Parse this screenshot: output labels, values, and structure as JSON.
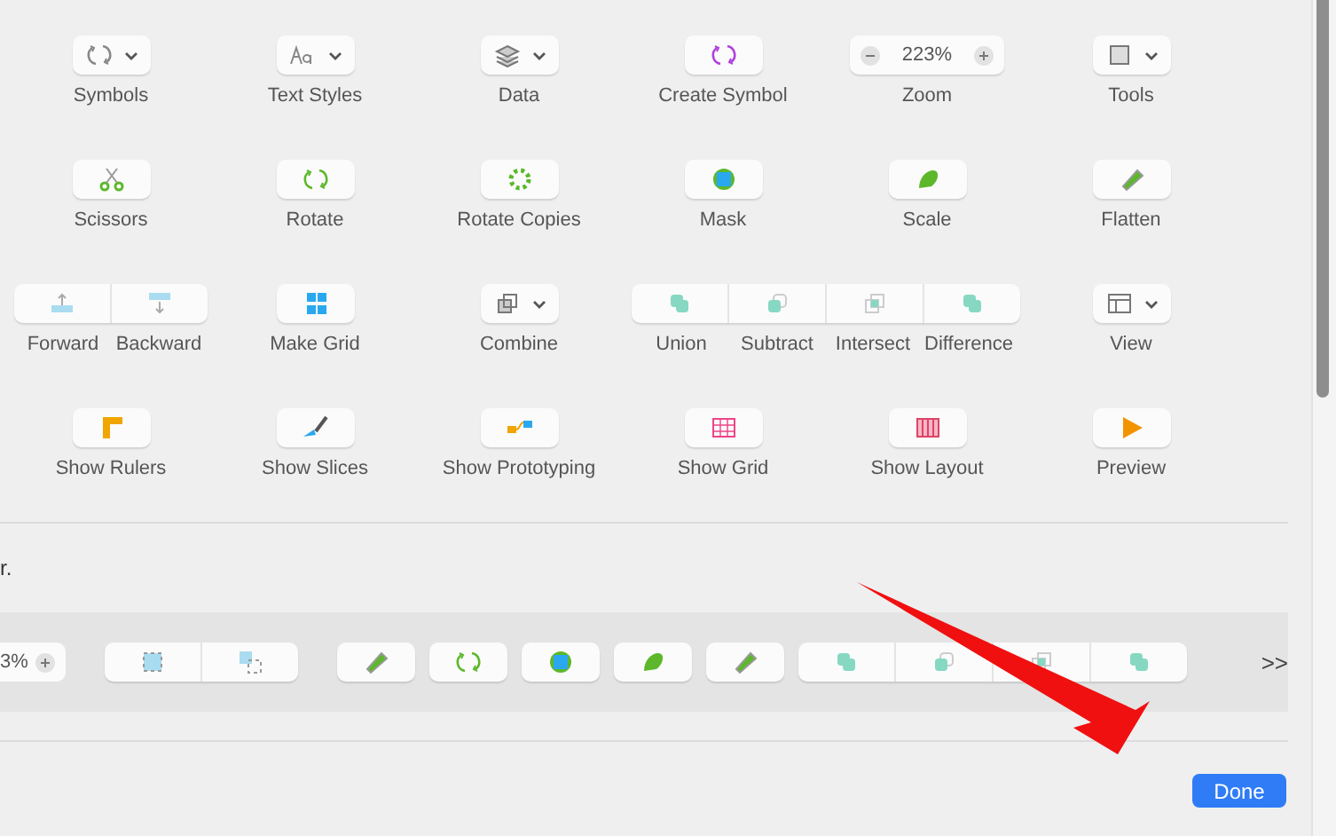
{
  "toolbar_items": [
    {
      "items": [
        {
          "kind": "dropdown",
          "label": "Symbols"
        },
        {
          "kind": "dropdown",
          "label": "Text Styles"
        },
        {
          "kind": "dropdown",
          "label": "Data"
        },
        {
          "kind": "button",
          "label": "Create Symbol"
        },
        {
          "kind": "zoom",
          "label": "Zoom",
          "value": "223%"
        },
        {
          "kind": "dropdown",
          "label": "Tools"
        }
      ]
    },
    {
      "items": [
        {
          "kind": "button",
          "label": "Scissors"
        },
        {
          "kind": "button",
          "label": "Rotate"
        },
        {
          "kind": "button",
          "label": "Rotate Copies"
        },
        {
          "kind": "button",
          "label": "Mask"
        },
        {
          "kind": "button",
          "label": "Scale"
        },
        {
          "kind": "button",
          "label": "Flatten"
        }
      ]
    },
    {
      "items": [
        {
          "kind": "group",
          "segments": [
            "Forward",
            "Backward"
          ]
        },
        {
          "kind": "button",
          "label": "Make Grid"
        },
        {
          "kind": "dropdown",
          "label": "Combine"
        },
        {
          "kind": "group",
          "segments": [
            "Union",
            "Subtract",
            "Intersect",
            "Difference"
          ]
        },
        {
          "kind": "dropdown",
          "label": "View"
        }
      ]
    },
    {
      "items": [
        {
          "kind": "button",
          "label": "Show Rulers"
        },
        {
          "kind": "button",
          "label": "Show Slices"
        },
        {
          "kind": "button",
          "label": "Show Prototyping"
        },
        {
          "kind": "button",
          "label": "Show Grid"
        },
        {
          "kind": "button",
          "label": "Show Layout"
        },
        {
          "kind": "button",
          "label": "Preview"
        }
      ]
    }
  ],
  "hint_text": "r.",
  "default_set": {
    "items": [
      {
        "kind": "zoom",
        "value": "3%"
      },
      {
        "kind": "pair"
      },
      {
        "kind": "button"
      },
      {
        "kind": "button"
      },
      {
        "kind": "button"
      },
      {
        "kind": "button"
      },
      {
        "kind": "button"
      },
      {
        "kind": "quad"
      }
    ],
    "overflow": ">>"
  },
  "done_button": "Done"
}
